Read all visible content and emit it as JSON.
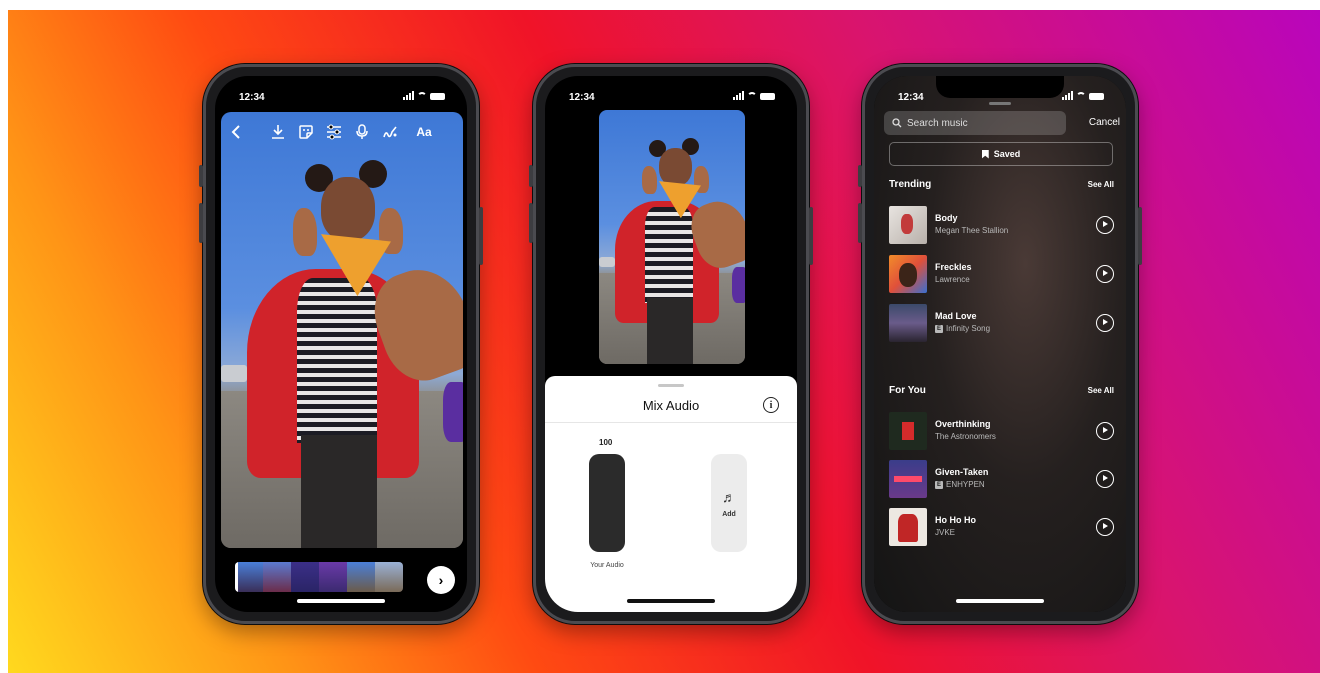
{
  "phones": {
    "editor": {
      "status_time": "12:34",
      "toolbar_icons": [
        "back-chevron-icon",
        "download-icon",
        "sticker-icon",
        "adjust-sliders-icon",
        "microphone-icon",
        "draw-scribble-icon",
        "text-icon"
      ],
      "text_button_label": "Aa",
      "next_glyph": "›"
    },
    "mix": {
      "status_time": "12:34",
      "sheet_title": "Mix Audio",
      "your_audio_value": "100",
      "your_audio_label": "Your Audio",
      "add_label": "Add"
    },
    "music": {
      "status_time": "12:34",
      "search_placeholder": "Search music",
      "cancel_label": "Cancel",
      "saved_label": "Saved",
      "sections": [
        {
          "title": "Trending",
          "see_all": "See All",
          "tracks": [
            {
              "name": "Body",
              "artist": "Megan Thee Stallion",
              "explicit": false
            },
            {
              "name": "Freckles",
              "artist": "Lawrence",
              "explicit": false
            },
            {
              "name": "Mad Love",
              "artist": "Infinity Song",
              "explicit": true
            }
          ]
        },
        {
          "title": "For You",
          "see_all": "See All",
          "tracks": [
            {
              "name": "Overthinking",
              "artist": "The Astronomers",
              "explicit": false
            },
            {
              "name": "Given-Taken",
              "artist": "ENHYPEN",
              "explicit": true
            },
            {
              "name": "Ho Ho Ho",
              "artist": "JVKE",
              "explicit": false
            }
          ]
        }
      ],
      "explicit_badge": "E"
    }
  },
  "colors": {
    "gradient": [
      "#ffd91e",
      "#ff9416",
      "#f01328",
      "#b905bc"
    ],
    "phone_frame": "#1b1b1d",
    "sheet": "#ffffff"
  }
}
